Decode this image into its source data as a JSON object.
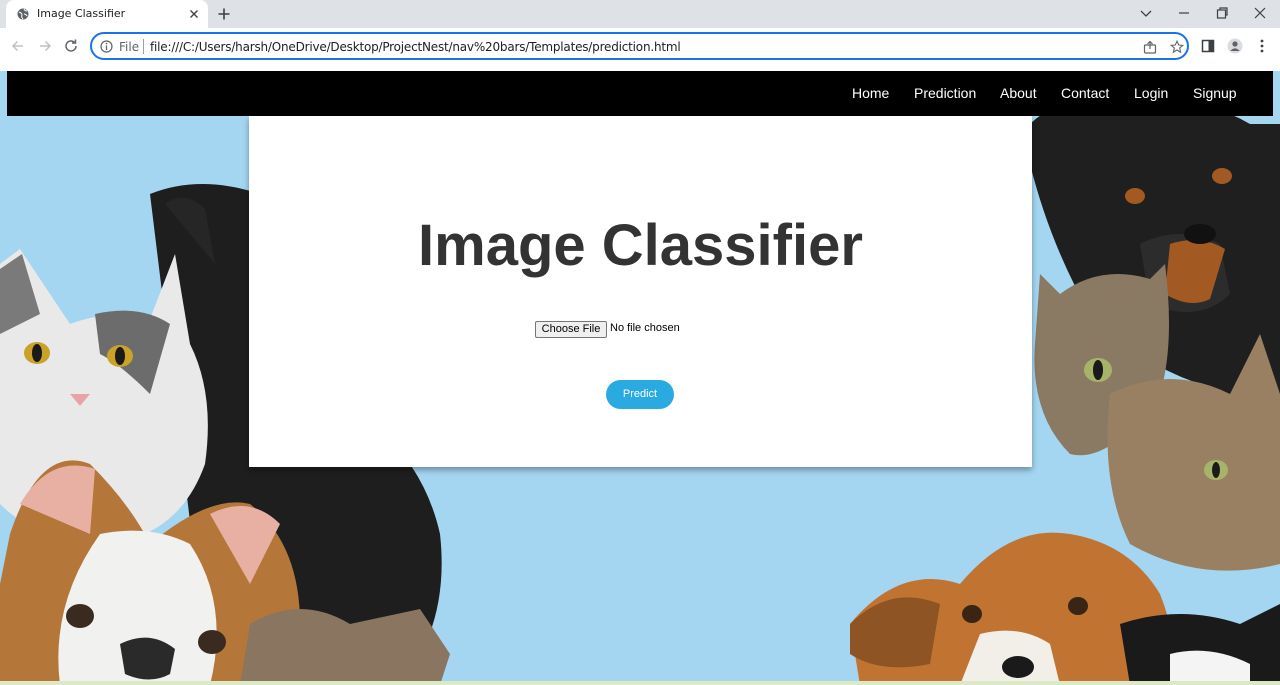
{
  "browser": {
    "tab": {
      "title": "Image Classifier"
    },
    "address_bar": {
      "scheme_label": "File",
      "url": "file:///C:/Users/harsh/OneDrive/Desktop/ProjectNest/nav%20bars/Templates/prediction.html"
    }
  },
  "navbar": {
    "links": [
      {
        "label": "Home"
      },
      {
        "label": "Prediction"
      },
      {
        "label": "About"
      },
      {
        "label": "Contact"
      },
      {
        "label": "Login"
      },
      {
        "label": "Signup"
      }
    ]
  },
  "main": {
    "heading": "Image Classifier",
    "file_input": {
      "button_label": "Choose File",
      "status": "No file chosen"
    },
    "predict_label": "Predict"
  },
  "colors": {
    "navbar_bg": "#000000",
    "page_bg": "#a4d6f2",
    "predict_button": "#29abe2",
    "heading_text": "#333333"
  },
  "background_image": {
    "subject": "cats-and-dogs-photo"
  }
}
